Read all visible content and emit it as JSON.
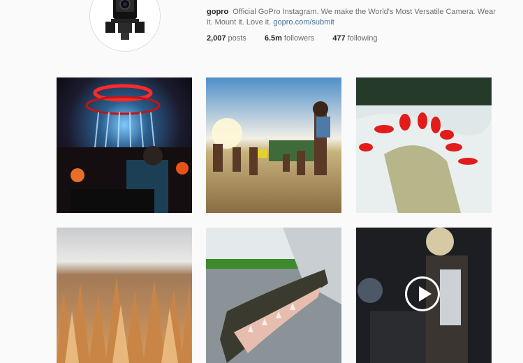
{
  "profile": {
    "username": "gopro",
    "bio": "Official GoPro Instagram. We make the World's Most Versatile Camera. Wear it. Mount it. Love it.",
    "link": "gopro.com/submit",
    "avatar_icon": "camera-icon"
  },
  "stats": {
    "posts_count": "2,007",
    "posts_label": "posts",
    "followers_count": "6.5m",
    "followers_label": "followers",
    "following_count": "477",
    "following_label": "following"
  },
  "posts": [
    {
      "subject": "concert-dj"
    },
    {
      "subject": "kids-on-beach"
    },
    {
      "subject": "whitewater-kayak"
    },
    {
      "subject": "canyon-hoodoos"
    },
    {
      "subject": "alligator"
    },
    {
      "subject": "musician-video",
      "is_video": true
    }
  ],
  "colors": {
    "link": "#3f729b",
    "background": "#fafafa"
  }
}
